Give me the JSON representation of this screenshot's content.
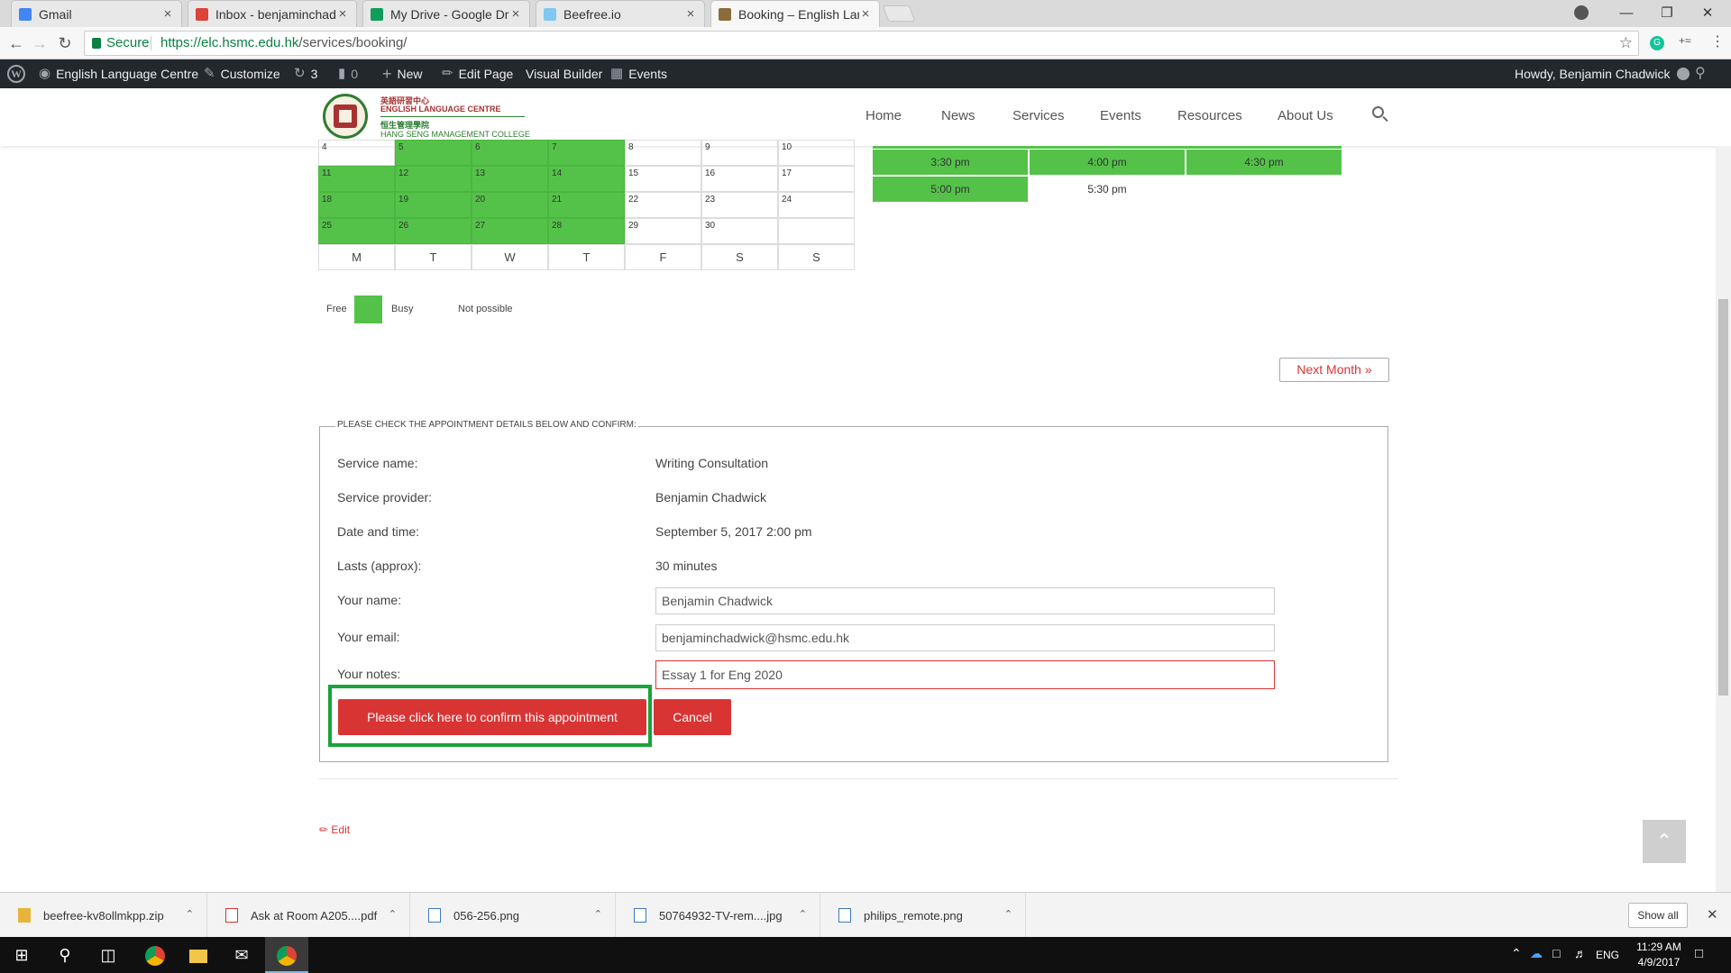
{
  "browser": {
    "tabs": [
      {
        "title": "Gmail",
        "icon": "google-icon",
        "color": "#4285f4",
        "active": false
      },
      {
        "title": "Inbox - benjaminchadwick",
        "icon": "gmail-icon",
        "color": "#db4437",
        "active": false
      },
      {
        "title": "My Drive - Google Drive",
        "icon": "drive-icon",
        "color": "#0f9d58",
        "active": false
      },
      {
        "title": "Beefree.io",
        "icon": "beefree-icon",
        "color": "#7fc8f0",
        "active": false
      },
      {
        "title": "Booking – English Langu",
        "icon": "site-icon",
        "color": "#8a6d3b",
        "active": true
      }
    ],
    "secure_label": "Secure",
    "url_domain": "https://elc.hsmc.edu.hk",
    "url_path": "/services/booking/"
  },
  "admin_bar": {
    "site_name": "English Language Centre",
    "customize": "Customize",
    "updates_count": "3",
    "comments_count": "0",
    "new": "New",
    "edit_page": "Edit Page",
    "visual_builder": "Visual Builder",
    "events": "Events",
    "howdy": "Howdy, Benjamin Chadwick"
  },
  "site": {
    "logo_line1": "英語研習中心",
    "logo_line2": "ENGLISH LANGUAGE CENTRE",
    "logo_line3": "恒生管理學院",
    "logo_line4": "HANG SENG MANAGEMENT COLLEGE",
    "nav": [
      "Home",
      "News",
      "Services",
      "Events",
      "Resources",
      "About Us"
    ]
  },
  "calendar": {
    "rows": [
      [
        {
          "d": "4",
          "g": false
        },
        {
          "d": "5",
          "g": true
        },
        {
          "d": "6",
          "g": true
        },
        {
          "d": "7",
          "g": true
        },
        {
          "d": "8",
          "g": false
        },
        {
          "d": "9",
          "g": false
        },
        {
          "d": "10",
          "g": false
        }
      ],
      [
        {
          "d": "11",
          "g": true
        },
        {
          "d": "12",
          "g": true
        },
        {
          "d": "13",
          "g": true
        },
        {
          "d": "14",
          "g": true
        },
        {
          "d": "15",
          "g": false
        },
        {
          "d": "16",
          "g": false
        },
        {
          "d": "17",
          "g": false
        }
      ],
      [
        {
          "d": "18",
          "g": true
        },
        {
          "d": "19",
          "g": true
        },
        {
          "d": "20",
          "g": true
        },
        {
          "d": "21",
          "g": true
        },
        {
          "d": "22",
          "g": false
        },
        {
          "d": "23",
          "g": false
        },
        {
          "d": "24",
          "g": false
        }
      ],
      [
        {
          "d": "25",
          "g": true
        },
        {
          "d": "26",
          "g": true
        },
        {
          "d": "27",
          "g": true
        },
        {
          "d": "28",
          "g": true
        },
        {
          "d": "29",
          "g": false
        },
        {
          "d": "30",
          "g": false
        },
        {
          "d": "",
          "g": false
        }
      ]
    ],
    "weekdays": [
      "M",
      "T",
      "W",
      "T",
      "F",
      "S",
      "S"
    ],
    "legend_free": "Free",
    "legend_busy": "Busy",
    "legend_not_possible": "Not possible",
    "free_color": "#54c249",
    "time_slots": [
      {
        "t": "3:30 pm",
        "g": true
      },
      {
        "t": "4:00 pm",
        "g": true
      },
      {
        "t": "4:30 pm",
        "g": true
      },
      {
        "t": "5:00 pm",
        "g": true
      },
      {
        "t": "5:30 pm",
        "g": false
      }
    ],
    "next_month": "Next Month »"
  },
  "confirm": {
    "legend": "PLEASE CHECK THE APPOINTMENT DETAILS BELOW AND CONFIRM:",
    "service_name_label": "Service name:",
    "service_name": "Writing Consultation",
    "provider_label": "Service provider:",
    "provider": "Benjamin Chadwick",
    "datetime_label": "Date and time:",
    "datetime": "September 5, 2017 2:00 pm",
    "lasts_label": "Lasts (approx):",
    "lasts": "30 minutes",
    "name_label": "Your name:",
    "name_value": "Benjamin Chadwick",
    "email_label": "Your email:",
    "email_value": "benjaminchadwick@hsmc.edu.hk",
    "notes_label": "Your notes:",
    "notes_value": "Essay 1 for Eng 2020",
    "confirm_button": "Please click here to confirm this appointment",
    "cancel_button": "Cancel",
    "button_color": "#d93434",
    "highlight_color": "#1aa33a"
  },
  "edit_link": "Edit",
  "downloads": {
    "items": [
      "beefree-kv8ollmkpp.zip",
      "Ask at Room A205....pdf",
      "056-256.png",
      "50764932-TV-rem....jpg",
      "philips_remote.png"
    ],
    "show_all": "Show all"
  },
  "taskbar": {
    "lang": "ENG",
    "time": "11:29 AM",
    "date": "4/9/2017"
  }
}
